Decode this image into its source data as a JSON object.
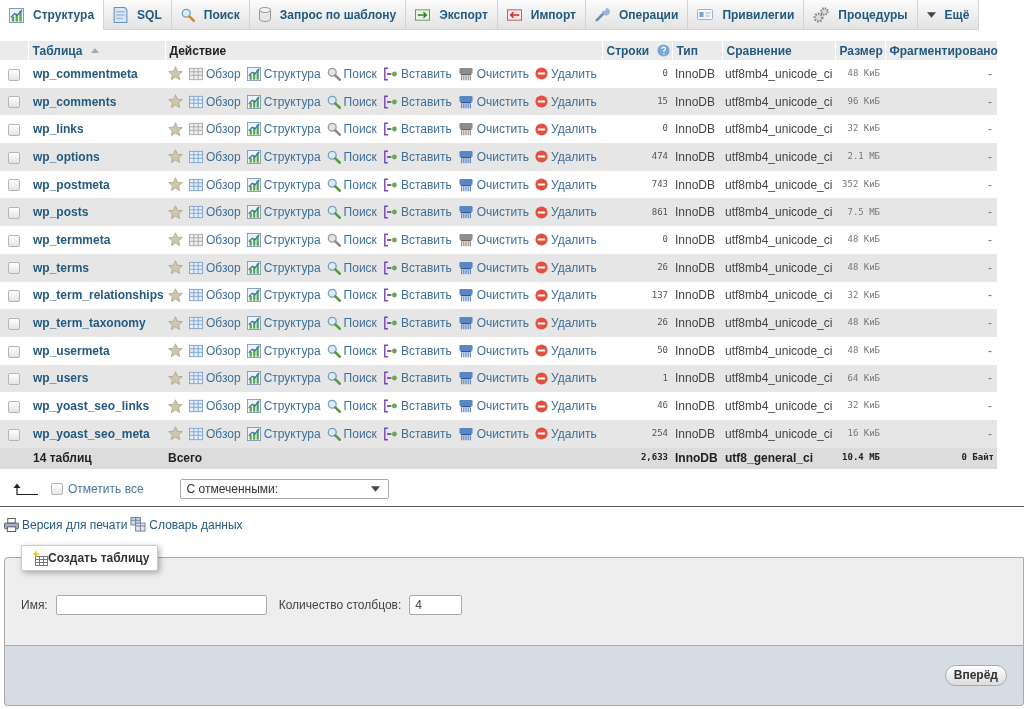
{
  "tabs": [
    {
      "label": "Структура",
      "selected": true
    },
    {
      "label": "SQL",
      "selected": false
    },
    {
      "label": "Поиск",
      "selected": false
    },
    {
      "label": "Запрос по шаблону",
      "selected": false
    },
    {
      "label": "Экспорт",
      "selected": false
    },
    {
      "label": "Импорт",
      "selected": false
    },
    {
      "label": "Операции",
      "selected": false
    },
    {
      "label": "Привилегии",
      "selected": false
    },
    {
      "label": "Процедуры",
      "selected": false
    },
    {
      "label": "Ещё",
      "selected": false
    }
  ],
  "table": {
    "columns": [
      {
        "label": "Таблица",
        "sortable": true,
        "sorted": true,
        "help": false
      },
      {
        "label": "Действие",
        "sortable": false,
        "sorted": false,
        "help": false
      },
      {
        "label": "Строки",
        "sortable": true,
        "sorted": false,
        "help": true
      },
      {
        "label": "Тип",
        "sortable": true,
        "sorted": false,
        "help": false
      },
      {
        "label": "Сравнение",
        "sortable": true,
        "sorted": false,
        "help": false
      },
      {
        "label": "Размер",
        "sortable": true,
        "sorted": false,
        "help": false
      },
      {
        "label": "Фрагментировано",
        "sortable": true,
        "sorted": false,
        "help": false
      }
    ],
    "rows": [
      {
        "checked": false,
        "favorite": false,
        "name": "wp_commentmeta",
        "empty": true,
        "actions": [
          "Обзор",
          "Структура",
          "Поиск",
          "Вставить",
          "Очистить",
          "Удалить"
        ],
        "rows": "0",
        "type": "InnoDB",
        "collation": "utf8mb4_unicode_ci",
        "size": "48 КиБ",
        "overhead": "-"
      },
      {
        "checked": false,
        "favorite": false,
        "name": "wp_comments",
        "empty": false,
        "actions": [
          "Обзор",
          "Структура",
          "Поиск",
          "Вставить",
          "Очистить",
          "Удалить"
        ],
        "rows": "15",
        "type": "InnoDB",
        "collation": "utf8mb4_unicode_ci",
        "size": "96 КиБ",
        "overhead": "-"
      },
      {
        "checked": false,
        "favorite": false,
        "name": "wp_links",
        "empty": true,
        "actions": [
          "Обзор",
          "Структура",
          "Поиск",
          "Вставить",
          "Очистить",
          "Удалить"
        ],
        "rows": "0",
        "type": "InnoDB",
        "collation": "utf8mb4_unicode_ci",
        "size": "32 КиБ",
        "overhead": "-"
      },
      {
        "checked": false,
        "favorite": false,
        "name": "wp_options",
        "empty": false,
        "actions": [
          "Обзор",
          "Структура",
          "Поиск",
          "Вставить",
          "Очистить",
          "Удалить"
        ],
        "rows": "474",
        "type": "InnoDB",
        "collation": "utf8mb4_unicode_ci",
        "size": "2.1 МБ",
        "overhead": "-"
      },
      {
        "checked": false,
        "favorite": false,
        "name": "wp_postmeta",
        "empty": false,
        "actions": [
          "Обзор",
          "Структура",
          "Поиск",
          "Вставить",
          "Очистить",
          "Удалить"
        ],
        "rows": "743",
        "type": "InnoDB",
        "collation": "utf8mb4_unicode_ci",
        "size": "352 КиБ",
        "overhead": "-"
      },
      {
        "checked": false,
        "favorite": false,
        "name": "wp_posts",
        "empty": false,
        "actions": [
          "Обзор",
          "Структура",
          "Поиск",
          "Вставить",
          "Очистить",
          "Удалить"
        ],
        "rows": "861",
        "type": "InnoDB",
        "collation": "utf8mb4_unicode_ci",
        "size": "7.5 МБ",
        "overhead": "-"
      },
      {
        "checked": false,
        "favorite": false,
        "name": "wp_termmeta",
        "empty": true,
        "actions": [
          "Обзор",
          "Структура",
          "Поиск",
          "Вставить",
          "Очистить",
          "Удалить"
        ],
        "rows": "0",
        "type": "InnoDB",
        "collation": "utf8mb4_unicode_ci",
        "size": "48 КиБ",
        "overhead": "-"
      },
      {
        "checked": false,
        "favorite": false,
        "name": "wp_terms",
        "empty": false,
        "actions": [
          "Обзор",
          "Структура",
          "Поиск",
          "Вставить",
          "Очистить",
          "Удалить"
        ],
        "rows": "26",
        "type": "InnoDB",
        "collation": "utf8mb4_unicode_ci",
        "size": "48 КиБ",
        "overhead": "-"
      },
      {
        "checked": false,
        "favorite": false,
        "name": "wp_term_relationships",
        "empty": false,
        "actions": [
          "Обзор",
          "Структура",
          "Поиск",
          "Вставить",
          "Очистить",
          "Удалить"
        ],
        "rows": "137",
        "type": "InnoDB",
        "collation": "utf8mb4_unicode_ci",
        "size": "32 КиБ",
        "overhead": "-"
      },
      {
        "checked": false,
        "favorite": false,
        "name": "wp_term_taxonomy",
        "empty": false,
        "actions": [
          "Обзор",
          "Структура",
          "Поиск",
          "Вставить",
          "Очистить",
          "Удалить"
        ],
        "rows": "26",
        "type": "InnoDB",
        "collation": "utf8mb4_unicode_ci",
        "size": "48 КиБ",
        "overhead": "-"
      },
      {
        "checked": false,
        "favorite": false,
        "name": "wp_usermeta",
        "empty": false,
        "actions": [
          "Обзор",
          "Структура",
          "Поиск",
          "Вставить",
          "Очистить",
          "Удалить"
        ],
        "rows": "50",
        "type": "InnoDB",
        "collation": "utf8mb4_unicode_ci",
        "size": "48 КиБ",
        "overhead": "-"
      },
      {
        "checked": false,
        "favorite": false,
        "name": "wp_users",
        "empty": false,
        "actions": [
          "Обзор",
          "Структура",
          "Поиск",
          "Вставить",
          "Очистить",
          "Удалить"
        ],
        "rows": "1",
        "type": "InnoDB",
        "collation": "utf8mb4_unicode_ci",
        "size": "64 КиБ",
        "overhead": "-"
      },
      {
        "checked": false,
        "favorite": false,
        "name": "wp_yoast_seo_links",
        "empty": false,
        "actions": [
          "Обзор",
          "Структура",
          "Поиск",
          "Вставить",
          "Очистить",
          "Удалить"
        ],
        "rows": "46",
        "type": "InnoDB",
        "collation": "utf8mb4_unicode_ci",
        "size": "32 КиБ",
        "overhead": "-"
      },
      {
        "checked": false,
        "favorite": false,
        "name": "wp_yoast_seo_meta",
        "empty": false,
        "actions": [
          "Обзор",
          "Структура",
          "Поиск",
          "Вставить",
          "Очистить",
          "Удалить"
        ],
        "rows": "254",
        "type": "InnoDB",
        "collation": "utf8mb4_unicode_ci",
        "size": "16 КиБ",
        "overhead": "-"
      }
    ],
    "summary": {
      "tables": "14 таблиц",
      "label": "Всего",
      "rows": "2,633",
      "type": "InnoDB",
      "collation": "utf8_general_ci",
      "size": "10.4 МБ",
      "overhead": "0 Байт"
    }
  },
  "bulk": {
    "check_all": {
      "label": "Отметить все",
      "checked": false
    },
    "with_selected": {
      "value": "С отмеченными:"
    }
  },
  "links": [
    "Версия для печати",
    "Словарь данных"
  ],
  "create_table": {
    "legend": "Создать таблицу",
    "name_label": "Имя:",
    "columns_label": "Количество столбцов:",
    "columns_value": "4",
    "submit": "Вперёд"
  }
}
